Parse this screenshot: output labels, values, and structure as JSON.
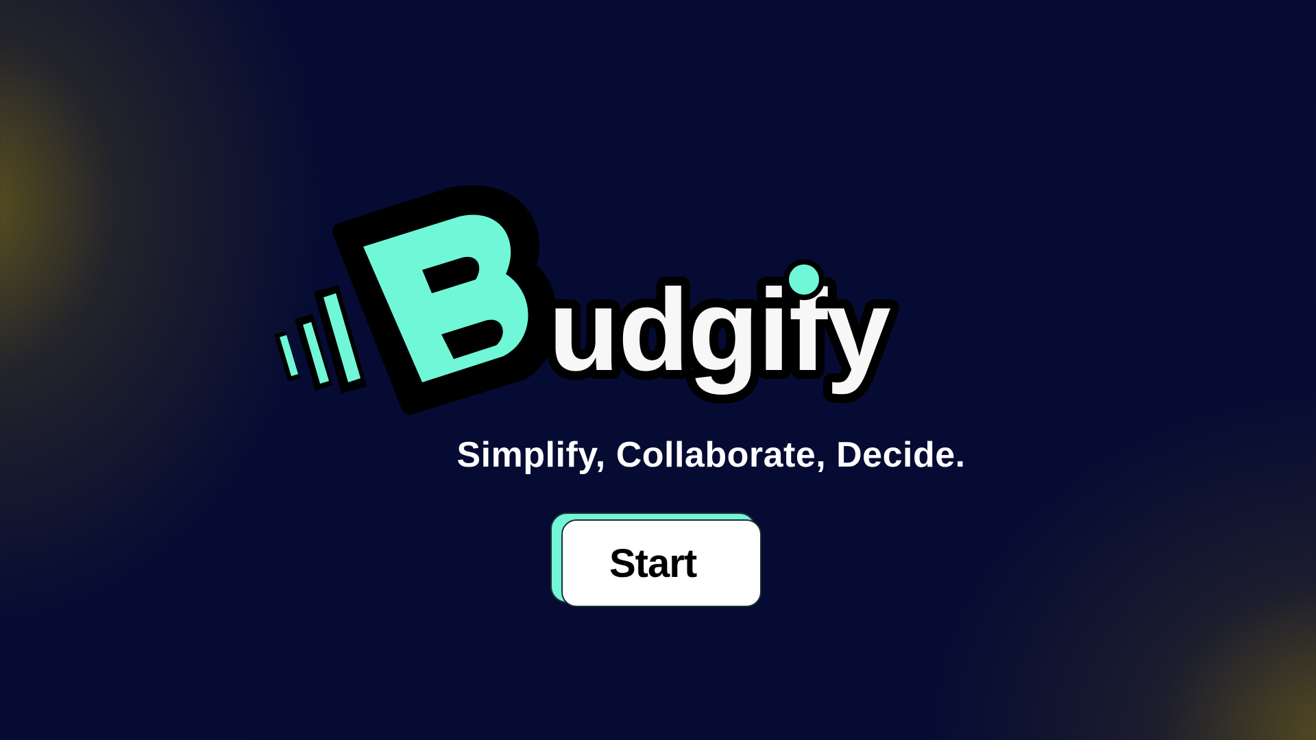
{
  "app": {
    "name_rest": "udgify",
    "logo_letter": "B",
    "tagline": "Simplify, Collaborate, Decide.",
    "start_label": "Start"
  },
  "colors": {
    "background": "#050b33",
    "accent": "#6ff7d7",
    "glow": "#62561c",
    "text": "#f7f7f7",
    "outline": "#000000"
  },
  "icons": {
    "logo": "budgify-logo",
    "speed_lines": "speed-lines-icon"
  }
}
